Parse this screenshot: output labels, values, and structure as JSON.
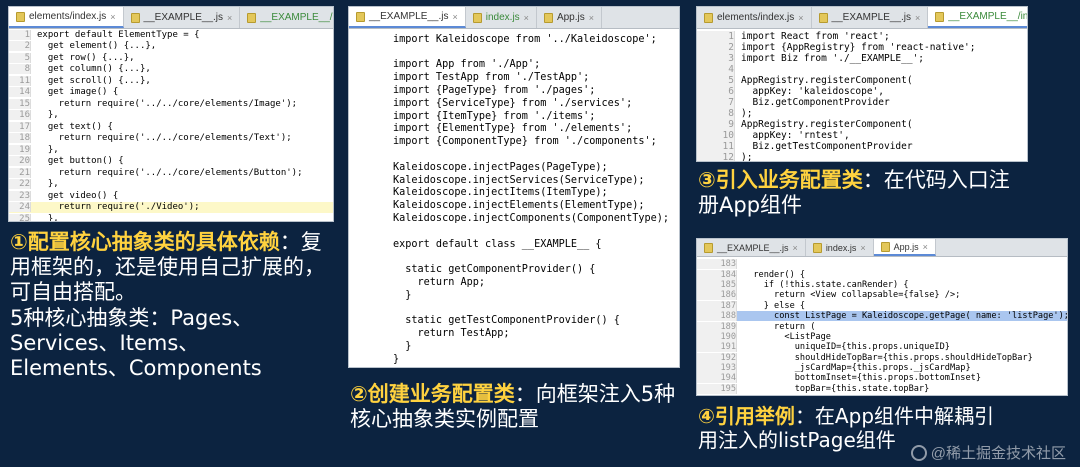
{
  "panel1": {
    "tabs": [
      {
        "label": "elements/index.js",
        "close": "×"
      },
      {
        "label": "__EXAMPLE__.js",
        "close": "×"
      },
      {
        "label": "__EXAMPLE__/index.js",
        "close": "×"
      }
    ],
    "lines": [
      {
        "n": "1",
        "t": "export default ElementType = {"
      },
      {
        "n": "2",
        "t": "  get element() {...},"
      },
      {
        "n": "5",
        "t": "  get row() {...},"
      },
      {
        "n": "8",
        "t": "  get column() {...},"
      },
      {
        "n": "11",
        "t": "  get scroll() {...},"
      },
      {
        "n": "14",
        "t": "  get image() {"
      },
      {
        "n": "15",
        "t": "    return require('../../core/elements/Image');"
      },
      {
        "n": "16",
        "t": "  },"
      },
      {
        "n": "17",
        "t": "  get text() {"
      },
      {
        "n": "18",
        "t": "    return require('../../core/elements/Text');"
      },
      {
        "n": "19",
        "t": "  },"
      },
      {
        "n": "20",
        "t": "  get button() {"
      },
      {
        "n": "21",
        "t": "    return require('../../core/elements/Button');"
      },
      {
        "n": "22",
        "t": "  },"
      },
      {
        "n": "23",
        "t": "  get video() {"
      },
      {
        "n": "24",
        "t": "    return require('./Video');"
      },
      {
        "n": "25",
        "t": "  },"
      }
    ]
  },
  "panel2": {
    "tabs": [
      {
        "label": "__EXAMPLE__.js",
        "close": "×"
      },
      {
        "label": "index.js",
        "close": "×"
      },
      {
        "label": "App.js",
        "close": "×"
      }
    ],
    "lines": [
      {
        "t": "import Kaleidoscope from '../Kaleidoscope';"
      },
      {
        "t": ""
      },
      {
        "t": "import App from './App';"
      },
      {
        "t": "import TestApp from './TestApp';"
      },
      {
        "t": "import {PageType} from './pages';"
      },
      {
        "t": "import {ServiceType} from './services';"
      },
      {
        "t": "import {ItemType} from './items';"
      },
      {
        "t": "import {ElementType} from './elements';"
      },
      {
        "t": "import {ComponentType} from './components';"
      },
      {
        "t": ""
      },
      {
        "t": "Kaleidoscope.injectPages(PageType);"
      },
      {
        "t": "Kaleidoscope.injectServices(ServiceType);"
      },
      {
        "t": "Kaleidoscope.injectItems(ItemType);"
      },
      {
        "t": "Kaleidoscope.injectElements(ElementType);"
      },
      {
        "t": "Kaleidoscope.injectComponents(ComponentType);"
      },
      {
        "t": ""
      },
      {
        "t": "export default class __EXAMPLE__ {"
      },
      {
        "t": ""
      },
      {
        "t": "  static getComponentProvider() {"
      },
      {
        "t": "    return App;"
      },
      {
        "t": "  }"
      },
      {
        "t": ""
      },
      {
        "t": "  static getTestComponentProvider() {"
      },
      {
        "t": "    return TestApp;"
      },
      {
        "t": "  }"
      },
      {
        "t": "}"
      }
    ]
  },
  "panel3": {
    "tabs": [
      {
        "label": "elements/index.js",
        "close": "×"
      },
      {
        "label": "__EXAMPLE__.js",
        "close": "×"
      },
      {
        "label": "__EXAMPLE__/index.js",
        "close": "×"
      }
    ],
    "lines": [
      {
        "n": "1",
        "t": "import React from 'react';"
      },
      {
        "n": "2",
        "t": "import {AppRegistry} from 'react-native';"
      },
      {
        "n": "3",
        "t": "import Biz from './__EXAMPLE__';"
      },
      {
        "n": "4",
        "t": ""
      },
      {
        "n": "5",
        "t": "AppRegistry.registerComponent("
      },
      {
        "n": "6",
        "t": "  appKey: 'kaleidoscope',"
      },
      {
        "n": "7",
        "t": "  Biz.getComponentProvider"
      },
      {
        "n": "8",
        "t": ");"
      },
      {
        "n": "9",
        "t": "AppRegistry.registerComponent("
      },
      {
        "n": "10",
        "t": "  appKey: 'rntest',"
      },
      {
        "n": "11",
        "t": "  Biz.getTestComponentProvider"
      },
      {
        "n": "12",
        "t": ");"
      }
    ]
  },
  "panel4": {
    "tabs": [
      {
        "label": "__EXAMPLE__.js",
        "close": "×"
      },
      {
        "label": "index.js",
        "close": "×"
      },
      {
        "label": "App.js",
        "close": "×"
      }
    ],
    "lines": [
      {
        "n": "183",
        "t": ""
      },
      {
        "n": "184",
        "t": "  render() {"
      },
      {
        "n": "185",
        "t": "    if (!this.state.canRender) {"
      },
      {
        "n": "186",
        "t": "      return <View collapsable={false} />;"
      },
      {
        "n": "187",
        "t": "    } else {"
      },
      {
        "n": "188",
        "t": "      const ListPage = Kaleidoscope.getPage( name: 'listPage');"
      },
      {
        "n": "189",
        "t": "      return ("
      },
      {
        "n": "190",
        "t": "        <ListPage"
      },
      {
        "n": "191",
        "t": "          uniqueID={this.props.uniqueID}"
      },
      {
        "n": "192",
        "t": "          shouldHideTopBar={this.props.shouldHideTopBar}"
      },
      {
        "n": "193",
        "t": "          _jsCardMap={this.props._jsCardMap}"
      },
      {
        "n": "194",
        "t": "          bottomInset={this.props.bottomInset}"
      },
      {
        "n": "195",
        "t": "          topBar={this.state.topBar}"
      }
    ]
  },
  "annotations": {
    "a1": {
      "head": "①配置核心抽象类的具体依赖",
      "body": "：复用框架的，还是使用自己扩展的，可自由搭配。",
      "extra1": "5种核心抽象类：Pages、",
      "extra2": "Services、Items、",
      "extra3": "Elements、Components"
    },
    "a2": {
      "head": "②创建业务配置类",
      "body": "：向框架注入5种核心抽象类实例配置"
    },
    "a3": {
      "head": "③引入业务配置类",
      "body": "：在代码入口注册App组件"
    },
    "a4": {
      "head": "④引用举例",
      "body": "：在App组件中解耦引用注入的listPage组件"
    }
  },
  "watermark": "@稀土掘金技术社区",
  "colors": {
    "background": "#0c2340",
    "accent": "#ffd23f",
    "keyword": "#000080",
    "string": "#008000"
  }
}
